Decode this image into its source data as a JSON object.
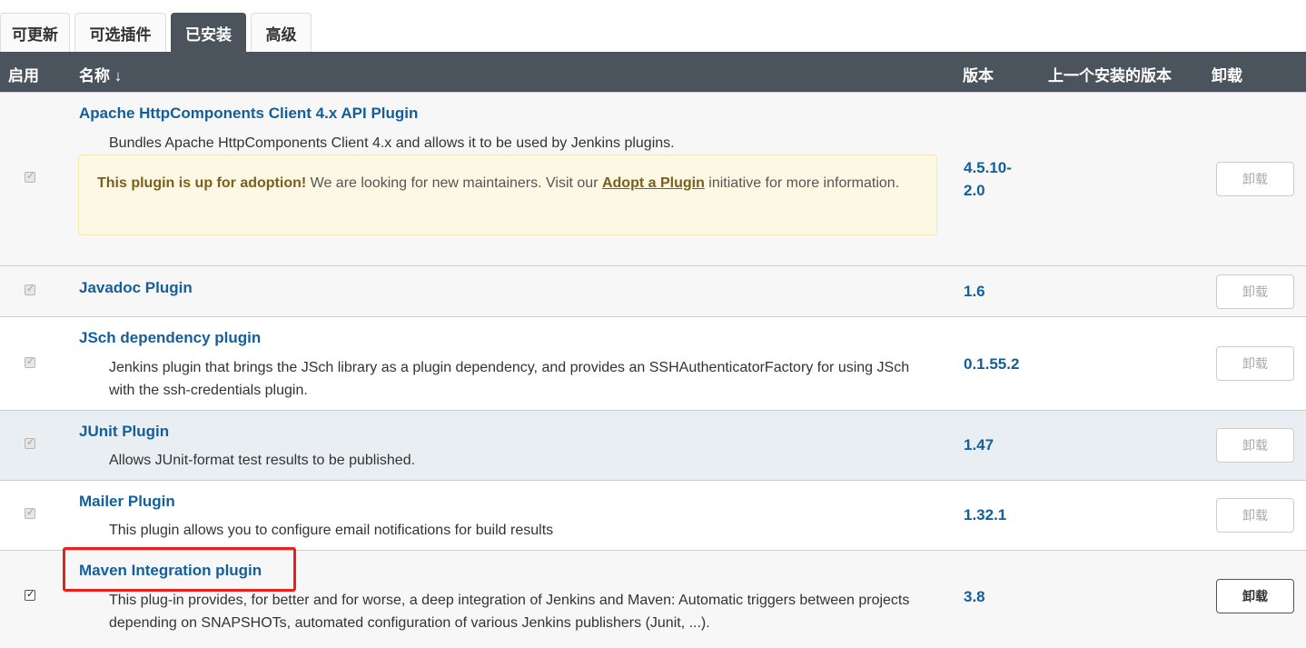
{
  "tabs": [
    {
      "label": "可更新"
    },
    {
      "label": "可选插件"
    },
    {
      "label": "已安装",
      "active": true
    },
    {
      "label": "高级"
    }
  ],
  "table_header": {
    "enabled": "启用",
    "name": "名称 ↓",
    "version": "版本",
    "previous_version": "上一个安装的版本",
    "uninstall": "卸载"
  },
  "plugins": [
    {
      "name": "Apache HttpComponents Client 4.x API Plugin",
      "description": "Bundles Apache HttpComponents Client 4.x and allows it to be used by Jenkins plugins.",
      "adoption": {
        "strong": "This plugin is up for adoption!",
        "text1": " We are looking for new maintainers. Visit our ",
        "link": "Adopt a Plugin",
        "text2": " initiative for more information."
      },
      "version": "4.5.10-2.0",
      "version_line1": "4.5.10-",
      "version_line2": "2.0",
      "uninstall_label": "卸载",
      "enabled": true
    },
    {
      "name": "Javadoc Plugin",
      "description": "",
      "version": "1.6",
      "uninstall_label": "卸载",
      "enabled": true
    },
    {
      "name": "JSch dependency plugin",
      "description": "Jenkins plugin that brings the JSch library as a plugin dependency, and provides an SSHAuthenticatorFactory for using JSch with the ssh-credentials plugin.",
      "version": "0.1.55.2",
      "uninstall_label": "卸载",
      "enabled": true
    },
    {
      "name": "JUnit Plugin",
      "description": "Allows JUnit-format test results to be published.",
      "version": "1.47",
      "uninstall_label": "卸载",
      "enabled": true
    },
    {
      "name": "Mailer Plugin",
      "description": "This plugin allows you to configure email notifications for build results",
      "version": "1.32.1",
      "uninstall_label": "卸载",
      "enabled": true
    },
    {
      "name": "Maven Integration plugin",
      "description": "This plug-in provides, for better and for worse, a deep integration of Jenkins and Maven: Automatic triggers between projects depending on SNAPSHOTs, automated configuration of various Jenkins publishers (Junit, ...).",
      "version": "3.8",
      "uninstall_label": "卸载",
      "enabled": true,
      "highlighted": true
    }
  ],
  "colors": {
    "header_bg": "#4b535d",
    "link": "#135f9b",
    "adoption_bg": "#fcf8e3",
    "highlight": "#e8211c"
  }
}
